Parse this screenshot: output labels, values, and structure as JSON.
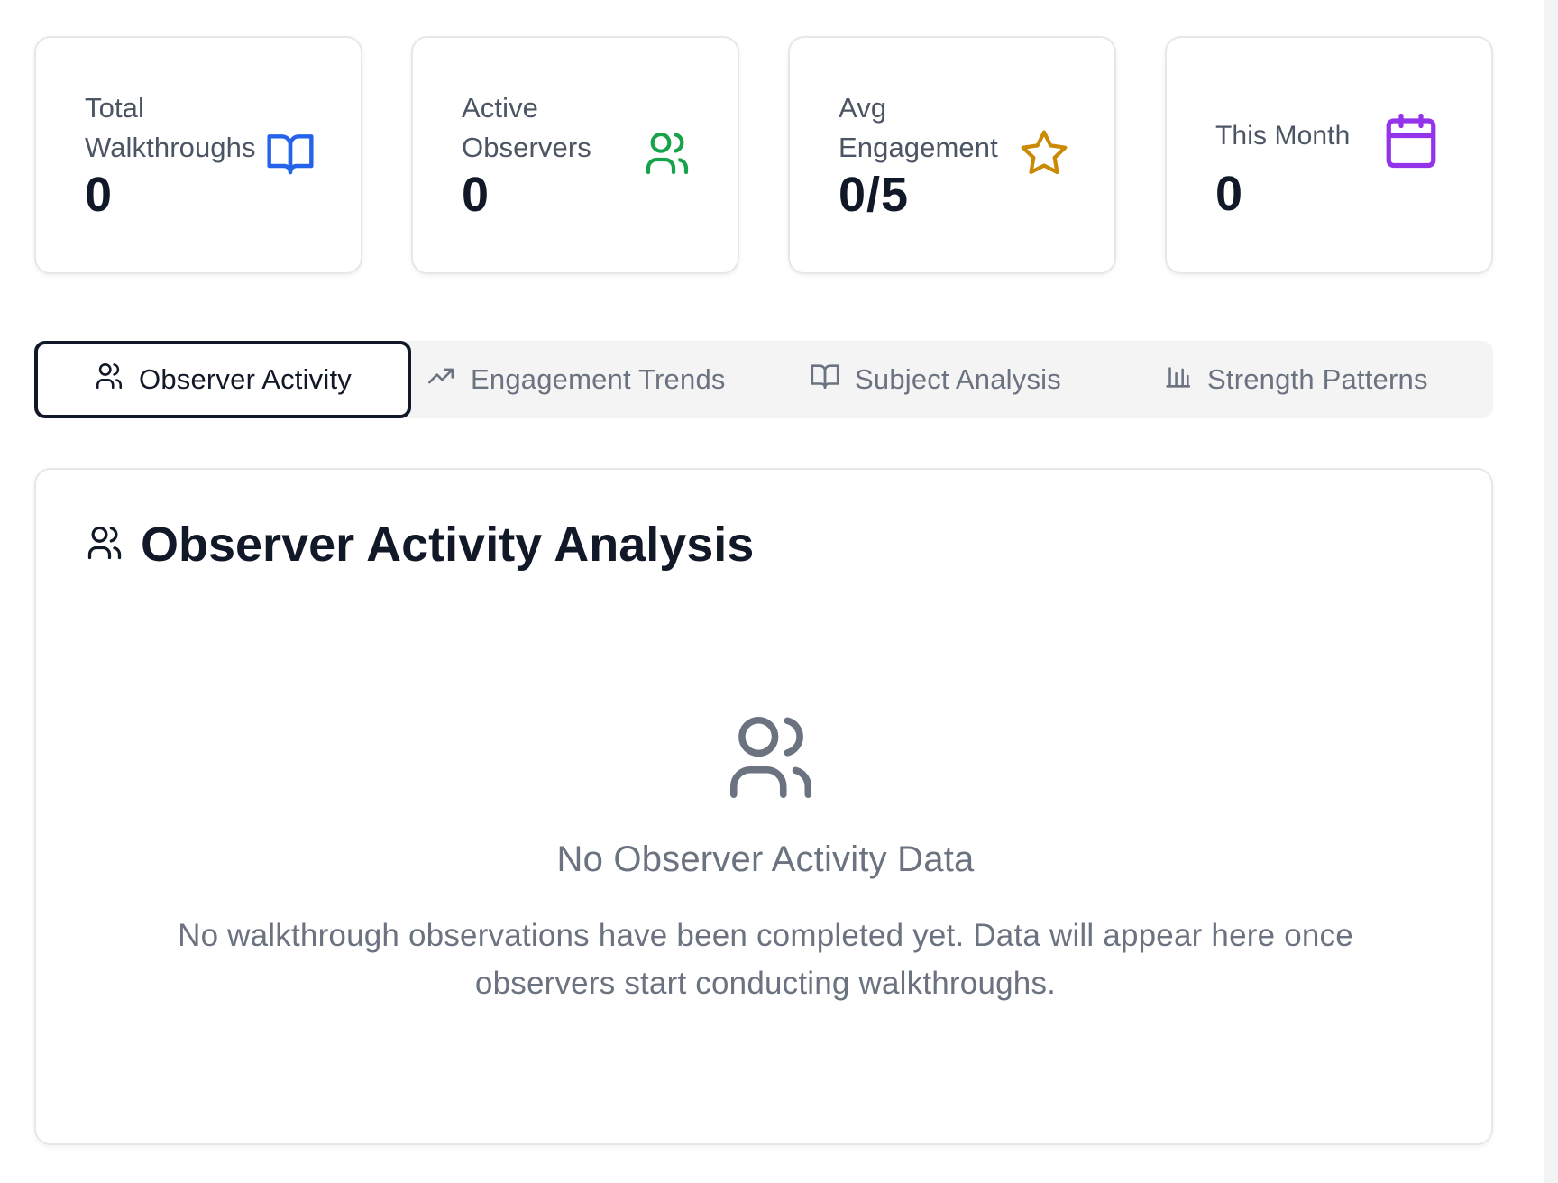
{
  "stats": [
    {
      "label": "Total Walkthroughs",
      "value": "0",
      "icon": "book-open-icon",
      "icon_color": "#2563eb"
    },
    {
      "label": "Active Observers",
      "value": "0",
      "icon": "users-icon",
      "icon_color": "#16a34a"
    },
    {
      "label": "Avg Engagement",
      "value": "0/5",
      "icon": "star-icon",
      "icon_color": "#ca8a04"
    },
    {
      "label": "This Month",
      "value": "0",
      "icon": "calendar-icon",
      "icon_color": "#9333ea"
    }
  ],
  "tabs": [
    {
      "label": "Observer Activity",
      "icon": "users-icon",
      "active": true
    },
    {
      "label": "Engagement Trends",
      "icon": "trending-up-icon",
      "active": false
    },
    {
      "label": "Subject Analysis",
      "icon": "book-open-icon",
      "active": false
    },
    {
      "label": "Strength Patterns",
      "icon": "bar-chart-icon",
      "active": false
    }
  ],
  "panel": {
    "title": "Observer Activity Analysis",
    "title_icon": "users-icon",
    "empty_state": {
      "icon": "users-icon",
      "title": "No Observer Activity Data",
      "description": "No walkthrough observations have been completed yet. Data will appear here once observers start conducting walkthroughs."
    }
  },
  "colors": {
    "active_tab_border": "#111827",
    "muted_text": "#6b7280",
    "card_border": "#e5e7eb"
  }
}
